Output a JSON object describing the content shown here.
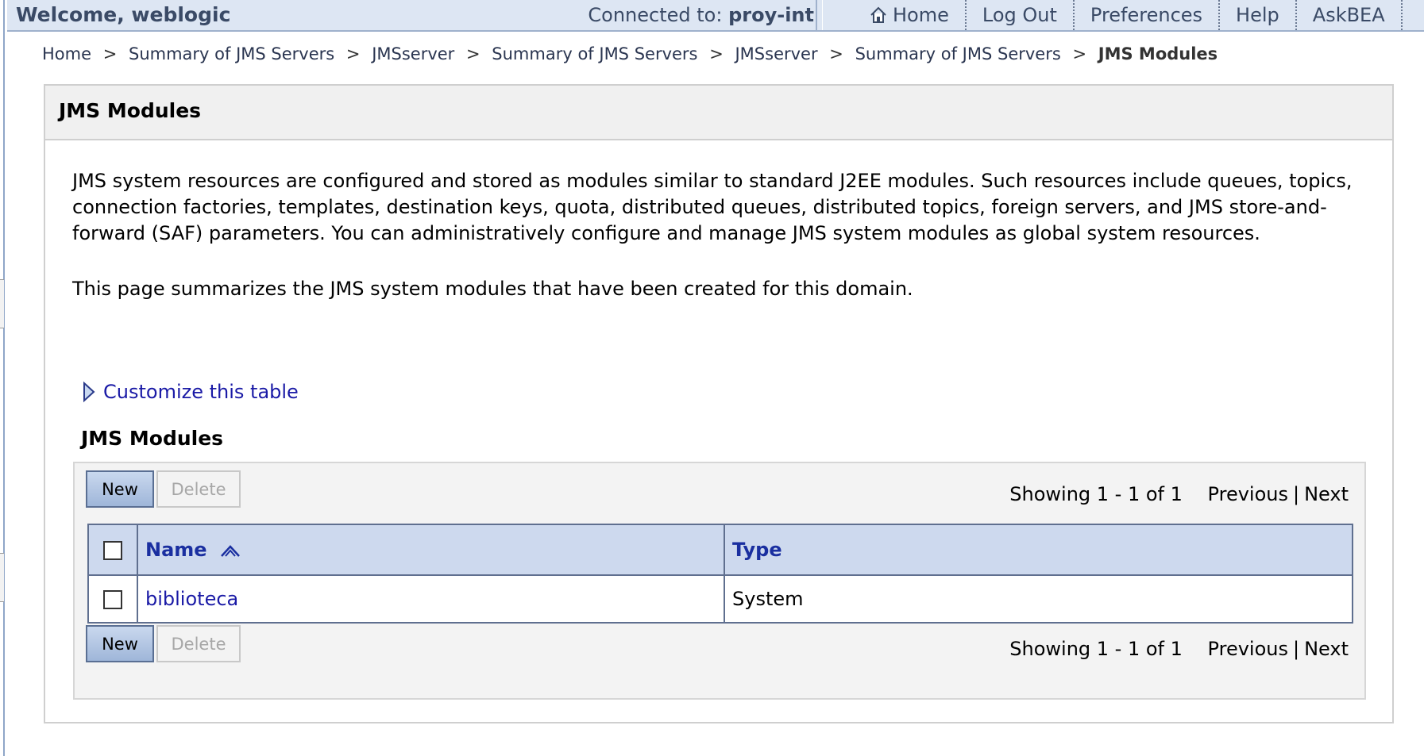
{
  "topbar": {
    "welcome": "Welcome, weblogic",
    "connected_label": "Connected to:",
    "connected_value": "proy-int",
    "links": [
      "Home",
      "Log Out",
      "Preferences",
      "Help",
      "AskBEA"
    ]
  },
  "breadcrumb": {
    "items": [
      "Home",
      "Summary of JMS Servers",
      "JMSserver",
      "Summary of JMS Servers",
      "JMSserver",
      "Summary of JMS Servers"
    ],
    "separator": ">",
    "current": "JMS Modules"
  },
  "panel": {
    "title": "JMS Modules",
    "description": "JMS system resources are configured and stored as modules similar to standard J2EE modules. Such resources include queues, topics, connection factories, templates, destination keys, quota, distributed queues, distributed topics, foreign servers, and JMS store-and-forward (SAF) parameters. You can administratively configure and manage JMS system modules as global system resources.",
    "summary": "This page summarizes the JMS system modules that have been created for this domain.",
    "customize_link": "Customize this table",
    "table_title": "JMS Modules"
  },
  "table": {
    "buttons": {
      "new": "New",
      "delete": "Delete"
    },
    "paging": {
      "showing": "Showing 1 - 1 of 1",
      "previous": "Previous",
      "separator": "|",
      "next": "Next"
    },
    "columns": [
      "Name",
      "Type"
    ],
    "rows": [
      {
        "name": "biblioteca",
        "type": "System"
      }
    ]
  },
  "colors": {
    "topbar_bg": "#dde6f3",
    "header_bg": "#cdd9ee",
    "link": "#1a1aa6",
    "header_text": "#1a2fa0"
  }
}
